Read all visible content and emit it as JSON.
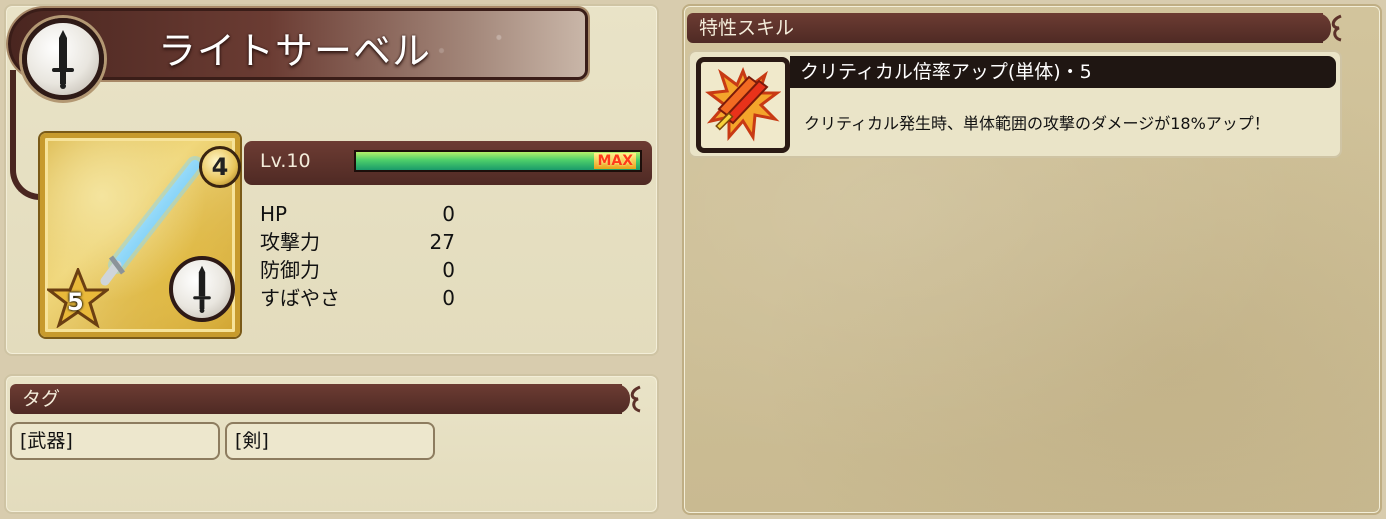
{
  "weapon": {
    "name": "ライトサーベル",
    "type_icon": "sword-icon",
    "rank": "4",
    "rarity": "5",
    "level": {
      "label": "Lv.10",
      "fill": 1.0,
      "max_label": "MAX"
    },
    "stats": [
      {
        "label": "HP",
        "value": "0"
      },
      {
        "label": "攻撃力",
        "value": "27"
      },
      {
        "label": "防御力",
        "value": "0"
      },
      {
        "label": "すばやさ",
        "value": "0"
      }
    ]
  },
  "tags": {
    "title": "タグ",
    "items": [
      "[武器]",
      "[剣]"
    ]
  },
  "skills": {
    "title": "特性スキル",
    "items": [
      {
        "name": "クリティカル倍率アップ(単体)・5",
        "description": "クリティカル発生時、単体範囲の攻撃のダメージが18%アップ！",
        "icon": "critical-slash-icon"
      }
    ]
  },
  "colors": {
    "bar": "#5c3129",
    "gauge": "#4dcf6a",
    "max": "#ff3a1a"
  }
}
